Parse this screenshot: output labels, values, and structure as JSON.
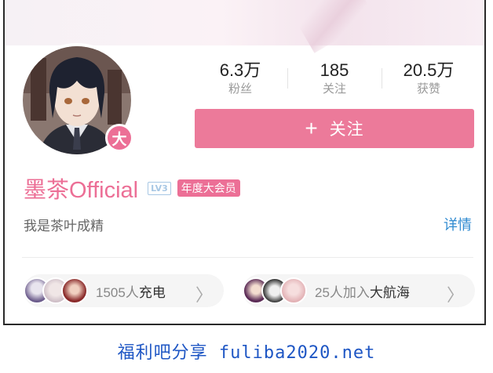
{
  "stats": [
    {
      "value": "6.3万",
      "label": "粉丝"
    },
    {
      "value": "185",
      "label": "关注"
    },
    {
      "value": "20.5万",
      "label": "获赞"
    }
  ],
  "follow_button": {
    "icon": "plus-icon",
    "plus": "+",
    "label": "关注"
  },
  "avatar": {
    "badge": "大"
  },
  "profile": {
    "username": "墨茶Official",
    "level": "LV3",
    "member_tag": "年度大会员",
    "bio": "我是茶叶成精",
    "detail_link": "详情"
  },
  "charge": {
    "count": "1505人",
    "action": "充电",
    "chevron": "〉"
  },
  "crew": {
    "count": "25人加入",
    "action": "大航海",
    "chevron": "〉"
  },
  "watermark": "福利吧分享 fuliba2020.net",
  "colors": {
    "accent": "#ec6f96",
    "button": "#ec7a9a",
    "link": "#2f8ad0"
  }
}
